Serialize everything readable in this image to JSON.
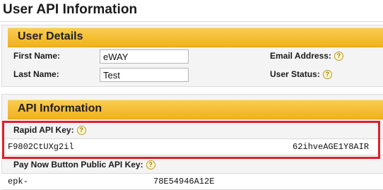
{
  "page": {
    "title": "User API Information"
  },
  "user_details": {
    "heading": "User Details",
    "first_name_label": "First Name:",
    "first_name_value": "eWAY",
    "last_name_label": "Last Name:",
    "last_name_value": "Test",
    "email_label": "Email Address:",
    "status_label": "User Status:"
  },
  "api_info": {
    "heading": "API Information",
    "rapid_label": "Rapid API Key:",
    "rapid_key_part1": "F9802CtUXg2il",
    "rapid_key_part2": "62ihveAGE1Y8AIR",
    "paynow_label": "Pay Now Button Public API Key:",
    "paynow_key_part1": "epk-",
    "paynow_key_part2": "78E54946A12E"
  },
  "icons": {
    "help": "question-mark-circle-icon"
  },
  "colors": {
    "header_gold": "#f2b01e",
    "highlight_red": "#e01f2a"
  }
}
